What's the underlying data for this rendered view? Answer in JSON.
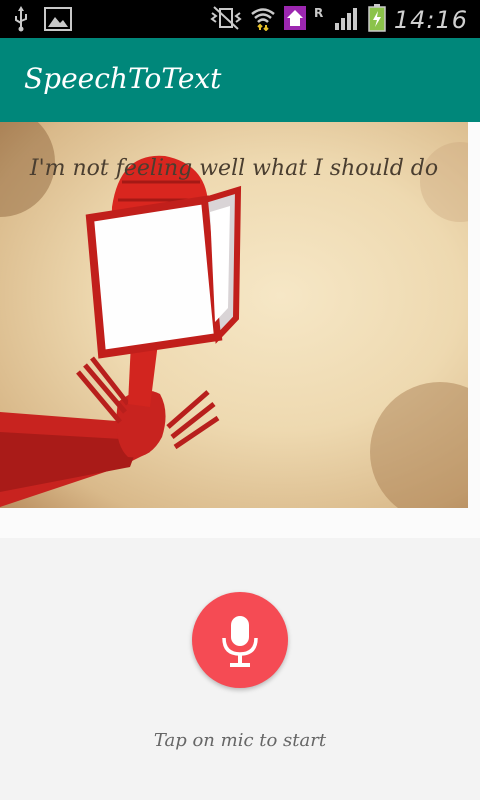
{
  "status_bar": {
    "time": "14:16",
    "icons": [
      "usb-icon",
      "image-icon",
      "vibrate-icon",
      "wifi-icon",
      "home-icon",
      "roaming-icon",
      "signal-icon",
      "battery-charging-icon"
    ]
  },
  "app": {
    "title": "SpeechToText"
  },
  "main": {
    "recognized_text": "I'm not feeling well what I should do",
    "image_icon": "microphone-poster-image",
    "mic_button_icon": "microphone-icon",
    "hint": "Tap on mic to start"
  },
  "colors": {
    "toolbar": "#00877a",
    "mic_button": "#f54b54",
    "status_bar": "#000000"
  }
}
